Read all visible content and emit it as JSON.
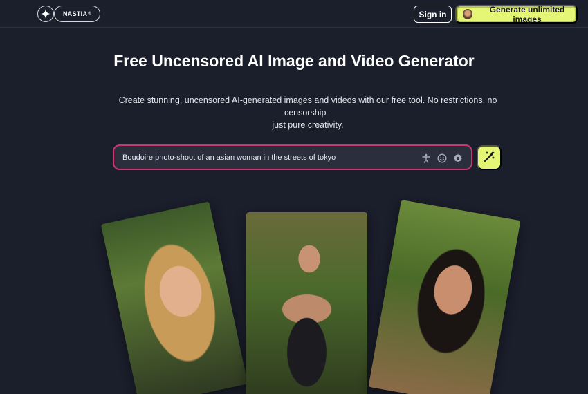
{
  "header": {
    "logo_text": "NASTIA",
    "logo_mark": "®",
    "signin_label": "Sign in",
    "cta_label": "Generate unlimited images"
  },
  "hero": {
    "title": "Free Uncensored AI Image and Video Generator",
    "subtitle_line1": "Create stunning, uncensored AI-generated images and videos with our free tool. No restrictions, no censorship -",
    "subtitle_line2": "just pure creativity."
  },
  "prompt": {
    "value": "Boudoire photo-shoot of an asian woman in the streets of tokyo",
    "icons": [
      "person-icon",
      "face-icon",
      "settings-icon"
    ],
    "submit_icon": "magic-wand-icon"
  },
  "colors": {
    "background": "#1b1e2b",
    "accent": "#e5f576",
    "prompt_border": "#c8386e"
  },
  "gallery": {
    "images": [
      "portrait-blonde",
      "portrait-black-dress",
      "portrait-selfie"
    ]
  }
}
